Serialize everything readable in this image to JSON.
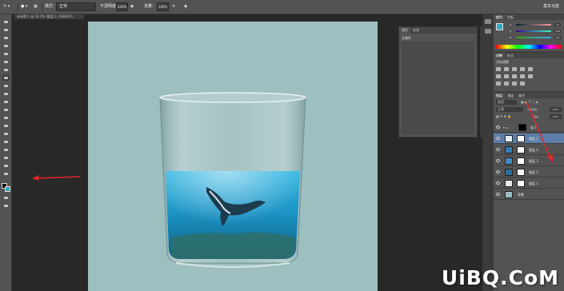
{
  "options_bar": {
    "mode_label": "模式：",
    "mode_value": "正常",
    "opacity_label": "不透明度：",
    "opacity_value": "100%",
    "flow_label": "流量：",
    "flow_value": "100%",
    "workspace": "基本功能"
  },
  "document_tab": "未标题-1 @ 33.3% (图层 1, RGB/8#)",
  "float_panel": {
    "tabs": [
      "属性",
      "信息"
    ],
    "label": "无属性"
  },
  "color_panel": {
    "tabs": [
      "颜色",
      "色板"
    ],
    "sliders": [
      {
        "channel": "R",
        "value": "54",
        "color": "#d9534f"
      },
      {
        "channel": "G",
        "value": "168",
        "color": "#4cae4c"
      },
      {
        "channel": "B",
        "value": "185",
        "color": "#3b7bd9"
      }
    ]
  },
  "adjust_panel": {
    "tabs": [
      "调整",
      "样式"
    ],
    "label": "添加调整"
  },
  "layers_panel": {
    "tabs": [
      "图层",
      "通道",
      "路径"
    ],
    "kind_label": "类型",
    "blend_mode": "正常",
    "opacity_label": "不透明度：",
    "opacity_value": "100%",
    "fill_label": "填充：",
    "fill_value": "100%",
    "group_name": "组 1",
    "layers": [
      {
        "name": "图层 1",
        "thumb": "#e9eef0",
        "selected": true
      },
      {
        "name": "图层 4",
        "thumb": "#2e7fb4",
        "selected": false
      },
      {
        "name": "图层 3",
        "thumb": "#3a8cc4",
        "selected": false
      },
      {
        "name": "图层 2",
        "thumb": "#2a6f9e",
        "selected": false
      },
      {
        "name": "图层 1",
        "thumb": "#e8eaea",
        "selected": false
      },
      {
        "name": "背景",
        "thumb": "#9ebfbf",
        "selected": false
      }
    ]
  },
  "colors": {
    "canvas_bg": "#9ebfbf",
    "water": "#1e96c6",
    "annotation_red": "#e0262a",
    "selection": "#5d7ea8"
  },
  "watermark": "UiBQ.CoM"
}
